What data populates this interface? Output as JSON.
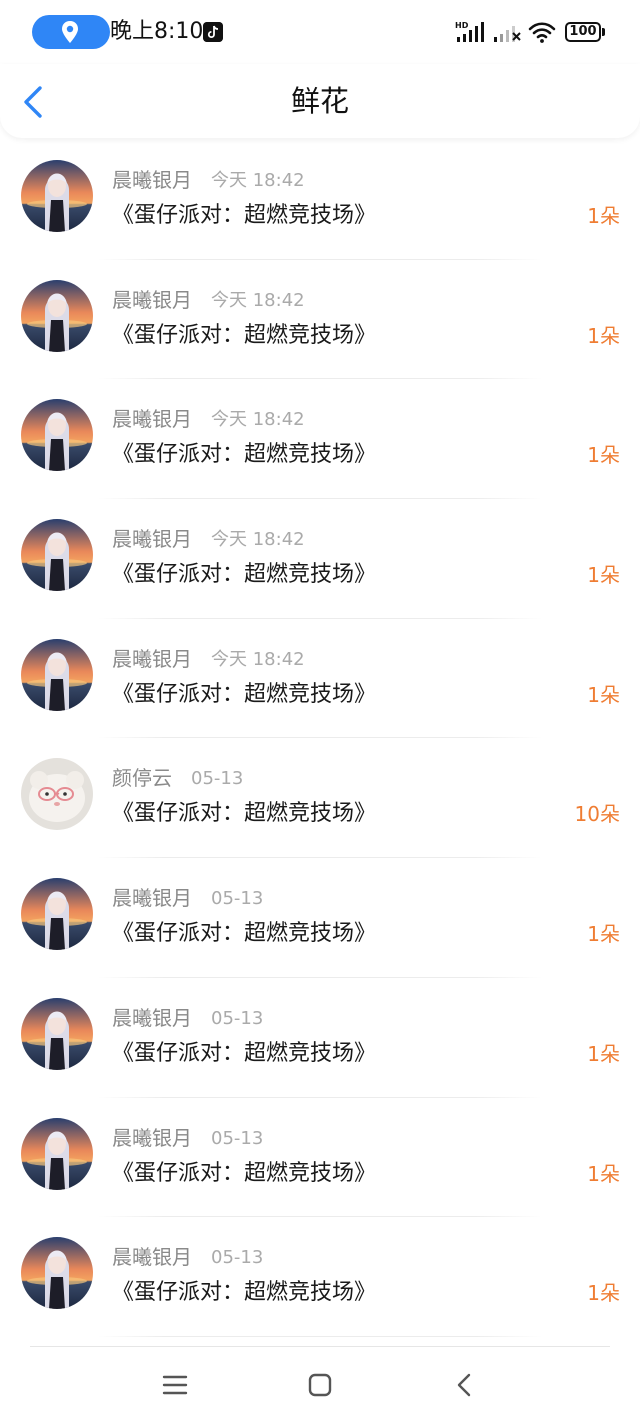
{
  "status_bar": {
    "time": "晚上8:10",
    "battery": "100",
    "network_label": "HD"
  },
  "header": {
    "title": "鲜花"
  },
  "colors": {
    "accent_blue": "#2f86f6",
    "count_orange": "#ef7d33"
  },
  "items": [
    {
      "name": "晨曦银月",
      "time": "今天 18:42",
      "game": "《蛋仔派对：超燃竞技场》",
      "count": "1朵",
      "avatar": "anime-girl-sunset"
    },
    {
      "name": "晨曦银月",
      "time": "今天 18:42",
      "game": "《蛋仔派对：超燃竞技场》",
      "count": "1朵",
      "avatar": "anime-girl-sunset"
    },
    {
      "name": "晨曦银月",
      "time": "今天 18:42",
      "game": "《蛋仔派对：超燃竞技场》",
      "count": "1朵",
      "avatar": "anime-girl-sunset"
    },
    {
      "name": "晨曦银月",
      "time": "今天 18:42",
      "game": "《蛋仔派对：超燃竞技场》",
      "count": "1朵",
      "avatar": "anime-girl-sunset"
    },
    {
      "name": "晨曦银月",
      "time": "今天 18:42",
      "game": "《蛋仔派对：超燃竞技场》",
      "count": "1朵",
      "avatar": "anime-girl-sunset"
    },
    {
      "name": "颜停云",
      "time": "05-13",
      "game": "《蛋仔派对：超燃竞技场》",
      "count": "10朵",
      "avatar": "plush-toy-glasses"
    },
    {
      "name": "晨曦银月",
      "time": "05-13",
      "game": "《蛋仔派对：超燃竞技场》",
      "count": "1朵",
      "avatar": "anime-girl-sunset"
    },
    {
      "name": "晨曦银月",
      "time": "05-13",
      "game": "《蛋仔派对：超燃竞技场》",
      "count": "1朵",
      "avatar": "anime-girl-sunset"
    },
    {
      "name": "晨曦银月",
      "time": "05-13",
      "game": "《蛋仔派对：超燃竞技场》",
      "count": "1朵",
      "avatar": "anime-girl-sunset"
    },
    {
      "name": "晨曦银月",
      "time": "05-13",
      "game": "《蛋仔派对：超燃竞技场》",
      "count": "1朵",
      "avatar": "anime-girl-sunset"
    }
  ]
}
